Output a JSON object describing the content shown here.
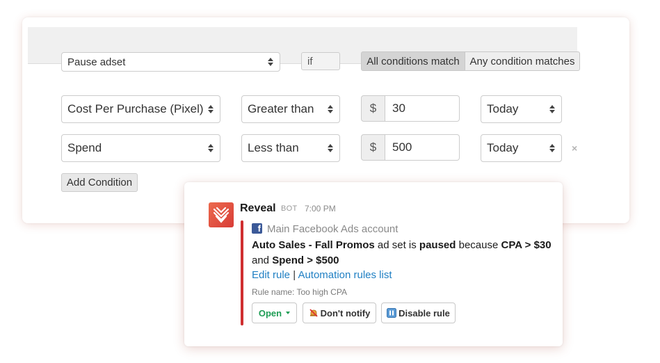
{
  "rule": {
    "action_select": "Pause adset",
    "if_label": "if",
    "match_all_label": "All conditions match",
    "match_any_label": "Any condition matches"
  },
  "conditions": [
    {
      "metric": "Cost Per Purchase (Pixel)",
      "operator": "Greater than",
      "currency": "$",
      "value": "30",
      "period": "Today"
    },
    {
      "metric": "Spend",
      "operator": "Less than",
      "currency": "$",
      "value": "500",
      "period": "Today"
    }
  ],
  "add_condition_label": "Add Condition",
  "remove_icon": "×",
  "message": {
    "bot_name": "Reveal",
    "bot_tag": "BOT",
    "time": "7:00 PM",
    "account": "Main Facebook Ads account",
    "adset_name": "Auto Sales - Fall Promos",
    "text_1": " ad set is ",
    "status": "paused",
    "text_2": " because ",
    "cond_1": "CPA > $30",
    "text_3": "and ",
    "cond_2": "Spend > $500",
    "edit_link": "Edit rule",
    "separator": "|",
    "list_link": "Automation rules list",
    "rule_name": "Rule name: Too high CPA",
    "btn_open": "Open",
    "btn_notify": "Don't notify",
    "btn_disable": "Disable rule",
    "accent_color": "#cf2f30",
    "link_color": "#1f7fc3",
    "logo_icon": "reveal-logo-icon",
    "fb_icon": "facebook-icon"
  }
}
